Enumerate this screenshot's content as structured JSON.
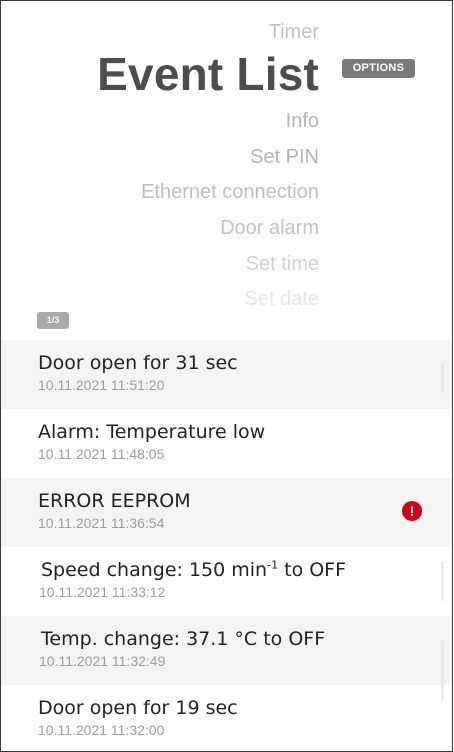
{
  "menu": {
    "items_above": [
      {
        "label": "Timer",
        "color": "#c2c2c2"
      }
    ],
    "active": {
      "label": "Event List"
    },
    "options_label": "OPTIONS",
    "items_below": [
      {
        "label": "Info",
        "color": "#b3b3b3"
      },
      {
        "label": "Set PIN",
        "color": "#b3b3b3"
      },
      {
        "label": "Ethernet connection",
        "color": "#bdbdbd"
      },
      {
        "label": "Door alarm",
        "color": "#c2c2c2"
      },
      {
        "label": "Set time",
        "color": "#d2d2d2"
      },
      {
        "label": "Set date",
        "color": "#e6e6e6"
      }
    ]
  },
  "page_indicator": "1/3",
  "events": [
    {
      "title": "Door open for 31 sec",
      "time": "10.11.2021 11:51:20",
      "error": false
    },
    {
      "title": "Alarm: Temperature low",
      "time": "10.11.2021 11:48:05",
      "error": false
    },
    {
      "title": "ERROR EEPROM",
      "time": "10.11.2021 11:36:54",
      "error": true,
      "icon": "error-exclamation-icon"
    },
    {
      "title_prefix": "Speed change: 150 min",
      "title_sup": "-1",
      "title_suffix": " to OFF",
      "time": "10.11.2021 11:33:12",
      "error": false
    },
    {
      "title": "Temp. change: 37.1 °C to OFF",
      "time": "10.11.2021 11:32:49",
      "error": false
    },
    {
      "title": "Door open for 19 sec",
      "time": "10.11.2021 11:32:00",
      "error": false
    }
  ],
  "colors": {
    "error_red": "#d0021b",
    "title": "#4d4d4d",
    "options_bg": "#7a7a7a"
  }
}
